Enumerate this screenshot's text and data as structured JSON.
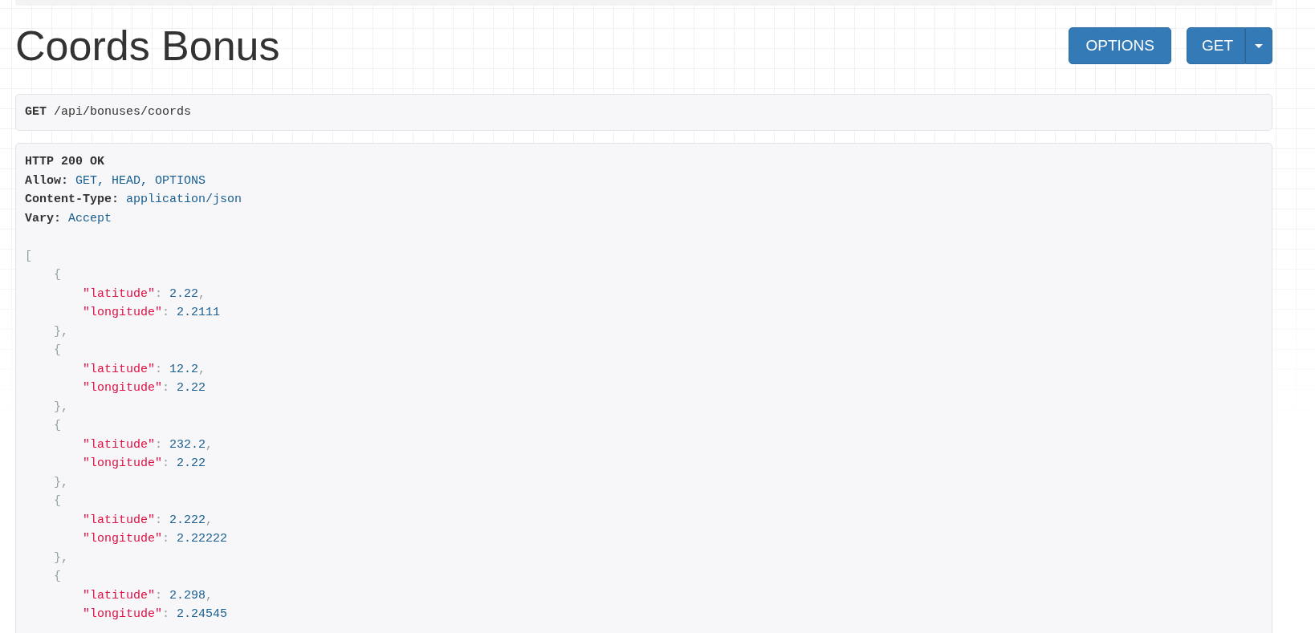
{
  "title": "Coords Bonus",
  "buttons": [
    {
      "label": "OPTIONS",
      "kind": "plain"
    },
    {
      "label": "GET",
      "kind": "split"
    }
  ],
  "request": {
    "method": "GET",
    "path": "/api/bonuses/coords"
  },
  "response": {
    "status": "HTTP 200 OK",
    "headers": [
      {
        "name": "Allow:",
        "value": "GET, HEAD, OPTIONS"
      },
      {
        "name": "Content-Type:",
        "value": "application/json"
      },
      {
        "name": "Vary:",
        "value": "Accept"
      }
    ],
    "body": {
      "open": "[",
      "children": [
        {
          "open": "{",
          "children": [
            {
              "key": "\"latitude\"",
              "colon": ":",
              "value": "2.22",
              "comma": ","
            },
            {
              "key": "\"longitude\"",
              "colon": ":",
              "value": "2.2111"
            }
          ],
          "close": "},"
        },
        {
          "open": "{",
          "children": [
            {
              "key": "\"latitude\"",
              "colon": ":",
              "value": "12.2",
              "comma": ","
            },
            {
              "key": "\"longitude\"",
              "colon": ":",
              "value": "2.22"
            }
          ],
          "close": "},"
        },
        {
          "open": "{",
          "children": [
            {
              "key": "\"latitude\"",
              "colon": ":",
              "value": "232.2",
              "comma": ","
            },
            {
              "key": "\"longitude\"",
              "colon": ":",
              "value": "2.22"
            }
          ],
          "close": "},"
        },
        {
          "open": "{",
          "children": [
            {
              "key": "\"latitude\"",
              "colon": ":",
              "value": "2.222",
              "comma": ","
            },
            {
              "key": "\"longitude\"",
              "colon": ":",
              "value": "2.22222"
            }
          ],
          "close": "},"
        },
        {
          "open": "{",
          "children": [
            {
              "key": "\"latitude\"",
              "colon": ":",
              "value": "2.298",
              "comma": ","
            },
            {
              "key": "\"longitude\"",
              "colon": ":",
              "value": "2.24545"
            }
          ]
        }
      ]
    }
  }
}
